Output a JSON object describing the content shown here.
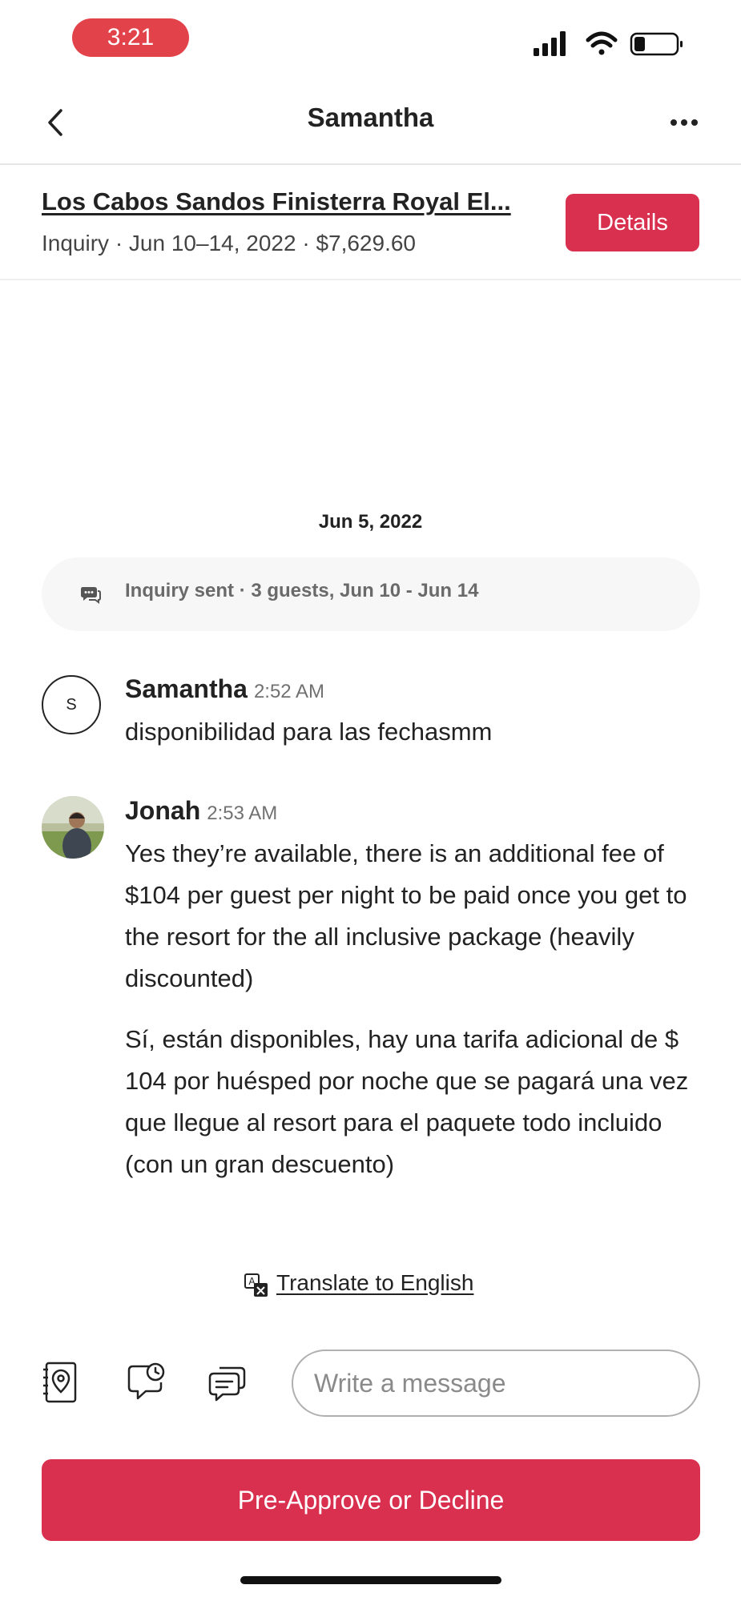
{
  "status_bar": {
    "time": "3:21",
    "icons": [
      "signal-icon",
      "wifi-icon",
      "battery-icon"
    ]
  },
  "header": {
    "title": "Samantha",
    "back_icon": "chevron-left-icon",
    "more_icon": "more-horizontal-icon"
  },
  "listing": {
    "title": "Los Cabos Sandos Finisterra Royal El...",
    "subtitle": "Inquiry · Jun 10–14, 2022 · $7,629.60",
    "details_label": "Details"
  },
  "thread": {
    "date": "Jun 5, 2022",
    "inquiry_text": "Inquiry sent · 3 guests, Jun 10 - Jun 14",
    "messages": [
      {
        "sender": "Samantha",
        "avatar_initial": "S",
        "time": "2:52 AM",
        "paragraphs": [
          "disponibilidad para las fechasmm"
        ]
      },
      {
        "sender": "Jonah",
        "time": "2:53 AM",
        "paragraphs": [
          "Yes they’re available, there is an additional fee of $104 per guest per night to be paid once you get to the resort for the all inclusive package (heavily discounted)",
          "Sí, están disponibles, hay una tarifa adicional de $ 104 por huésped por noche que se pagará una vez que llegue al resort para el paquete todo incluido (con un gran descuento)"
        ]
      }
    ],
    "translate_label": "Translate to English"
  },
  "composer": {
    "placeholder": "Write a message",
    "value": "",
    "tools": [
      "listing-pin-icon",
      "scheduled-message-icon",
      "quick-reply-icon"
    ]
  },
  "cta": {
    "label": "Pre-Approve or Decline"
  },
  "colors": {
    "brand": "#d9304f",
    "time_pill": "#e2434b",
    "text": "#222222",
    "muted": "#717171"
  }
}
